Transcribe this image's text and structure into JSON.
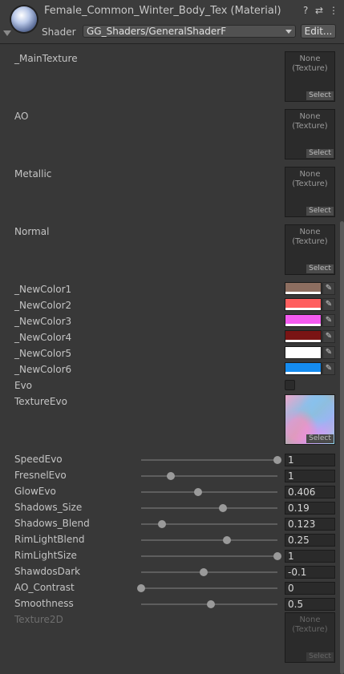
{
  "header": {
    "title": "Female_Common_Winter_Body_Tex (Material)",
    "shader_label": "Shader",
    "shader_value": "GG_Shaders/GeneralShaderF",
    "edit_button": "Edit...",
    "help_icon": "?",
    "settings_icon": "⇄",
    "menu_icon": "⋮"
  },
  "textures": [
    {
      "label": "_MainTexture",
      "value": "None\n(Texture)",
      "select": "Select"
    },
    {
      "label": "AO",
      "value": "None\n(Texture)",
      "select": "Select"
    },
    {
      "label": "Metallic",
      "value": "None\n(Texture)",
      "select": "Select"
    },
    {
      "label": "Normal",
      "value": "None\n(Texture)",
      "select": "Select"
    }
  ],
  "colors": [
    {
      "label": "_NewColor1",
      "hex": "#8d6e60"
    },
    {
      "label": "_NewColor2",
      "hex": "#ff5f5f"
    },
    {
      "label": "_NewColor3",
      "hex": "#f45bf0"
    },
    {
      "label": "_NewColor4",
      "hex": "#7a1414"
    },
    {
      "label": "_NewColor5",
      "hex": "#ffffff"
    },
    {
      "label": "_NewColor6",
      "hex": "#158cf0"
    }
  ],
  "evo": {
    "label": "Evo"
  },
  "texture_evo": {
    "label": "TextureEvo",
    "select": "Select"
  },
  "sliders": [
    {
      "label": "SpeedEvo",
      "value": "1",
      "fraction": 1.0
    },
    {
      "label": "FresnelEvo",
      "value": "1",
      "fraction": 0.22
    },
    {
      "label": "GlowEvo",
      "value": "0.406",
      "fraction": 0.42
    },
    {
      "label": "Shadows_Size",
      "value": "0.19",
      "fraction": 0.6
    },
    {
      "label": "Shadows_Blend",
      "value": "0.123",
      "fraction": 0.15
    },
    {
      "label": "RimLightBlend",
      "value": "0.25",
      "fraction": 0.63
    },
    {
      "label": "RimLightSize",
      "value": "1",
      "fraction": 1.0
    },
    {
      "label": "ShawdosDark",
      "value": "-0.1",
      "fraction": 0.46
    },
    {
      "label": "AO_Contrast",
      "value": "0",
      "fraction": 0.0
    },
    {
      "label": "Smoothness",
      "value": "0.5",
      "fraction": 0.51
    }
  ],
  "texture2d": {
    "label": "Texture2D",
    "value": "None\n(Texture)",
    "select": "Select"
  }
}
